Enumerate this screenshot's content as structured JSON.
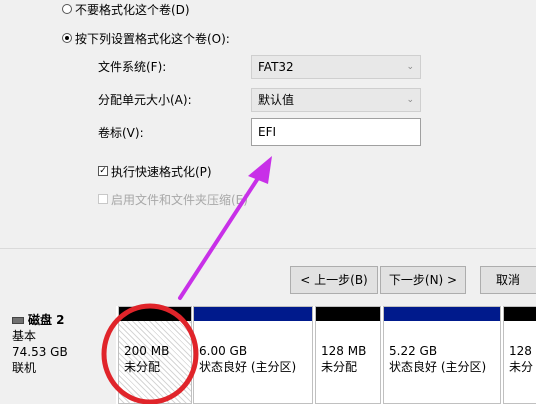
{
  "options": {
    "no_format": "不要格式化这个卷(D)",
    "format_with": "按下列设置格式化这个卷(O):"
  },
  "fields": {
    "filesystem_label": "文件系统(F):",
    "filesystem_value": "FAT32",
    "alloc_label": "分配单元大小(A):",
    "alloc_value": "默认值",
    "volume_label": "卷标(V):",
    "volume_value": "EFI"
  },
  "checks": {
    "quick_format": "执行快速格式化(P)",
    "compression": "启用文件和文件夹压缩(E)"
  },
  "buttons": {
    "back": "< 上一步(B)",
    "next": "下一步(N) >",
    "cancel": "取消"
  },
  "disk": {
    "name": "磁盘 2",
    "type": "基本",
    "size": "74.53 GB",
    "status": "联机",
    "partitions": [
      {
        "size": "200 MB",
        "status": "未分配"
      },
      {
        "size": "6.00 GB",
        "status": "状态良好 (主分区)"
      },
      {
        "size": "128 MB",
        "status": "未分配"
      },
      {
        "size": "5.22 GB",
        "status": "状态良好 (主分区)"
      },
      {
        "size": "128",
        "status": "未分"
      }
    ]
  },
  "colors": {
    "annotation": "#e0242a",
    "arrow": "#c830e8",
    "primary_bar": "#001a8c"
  }
}
